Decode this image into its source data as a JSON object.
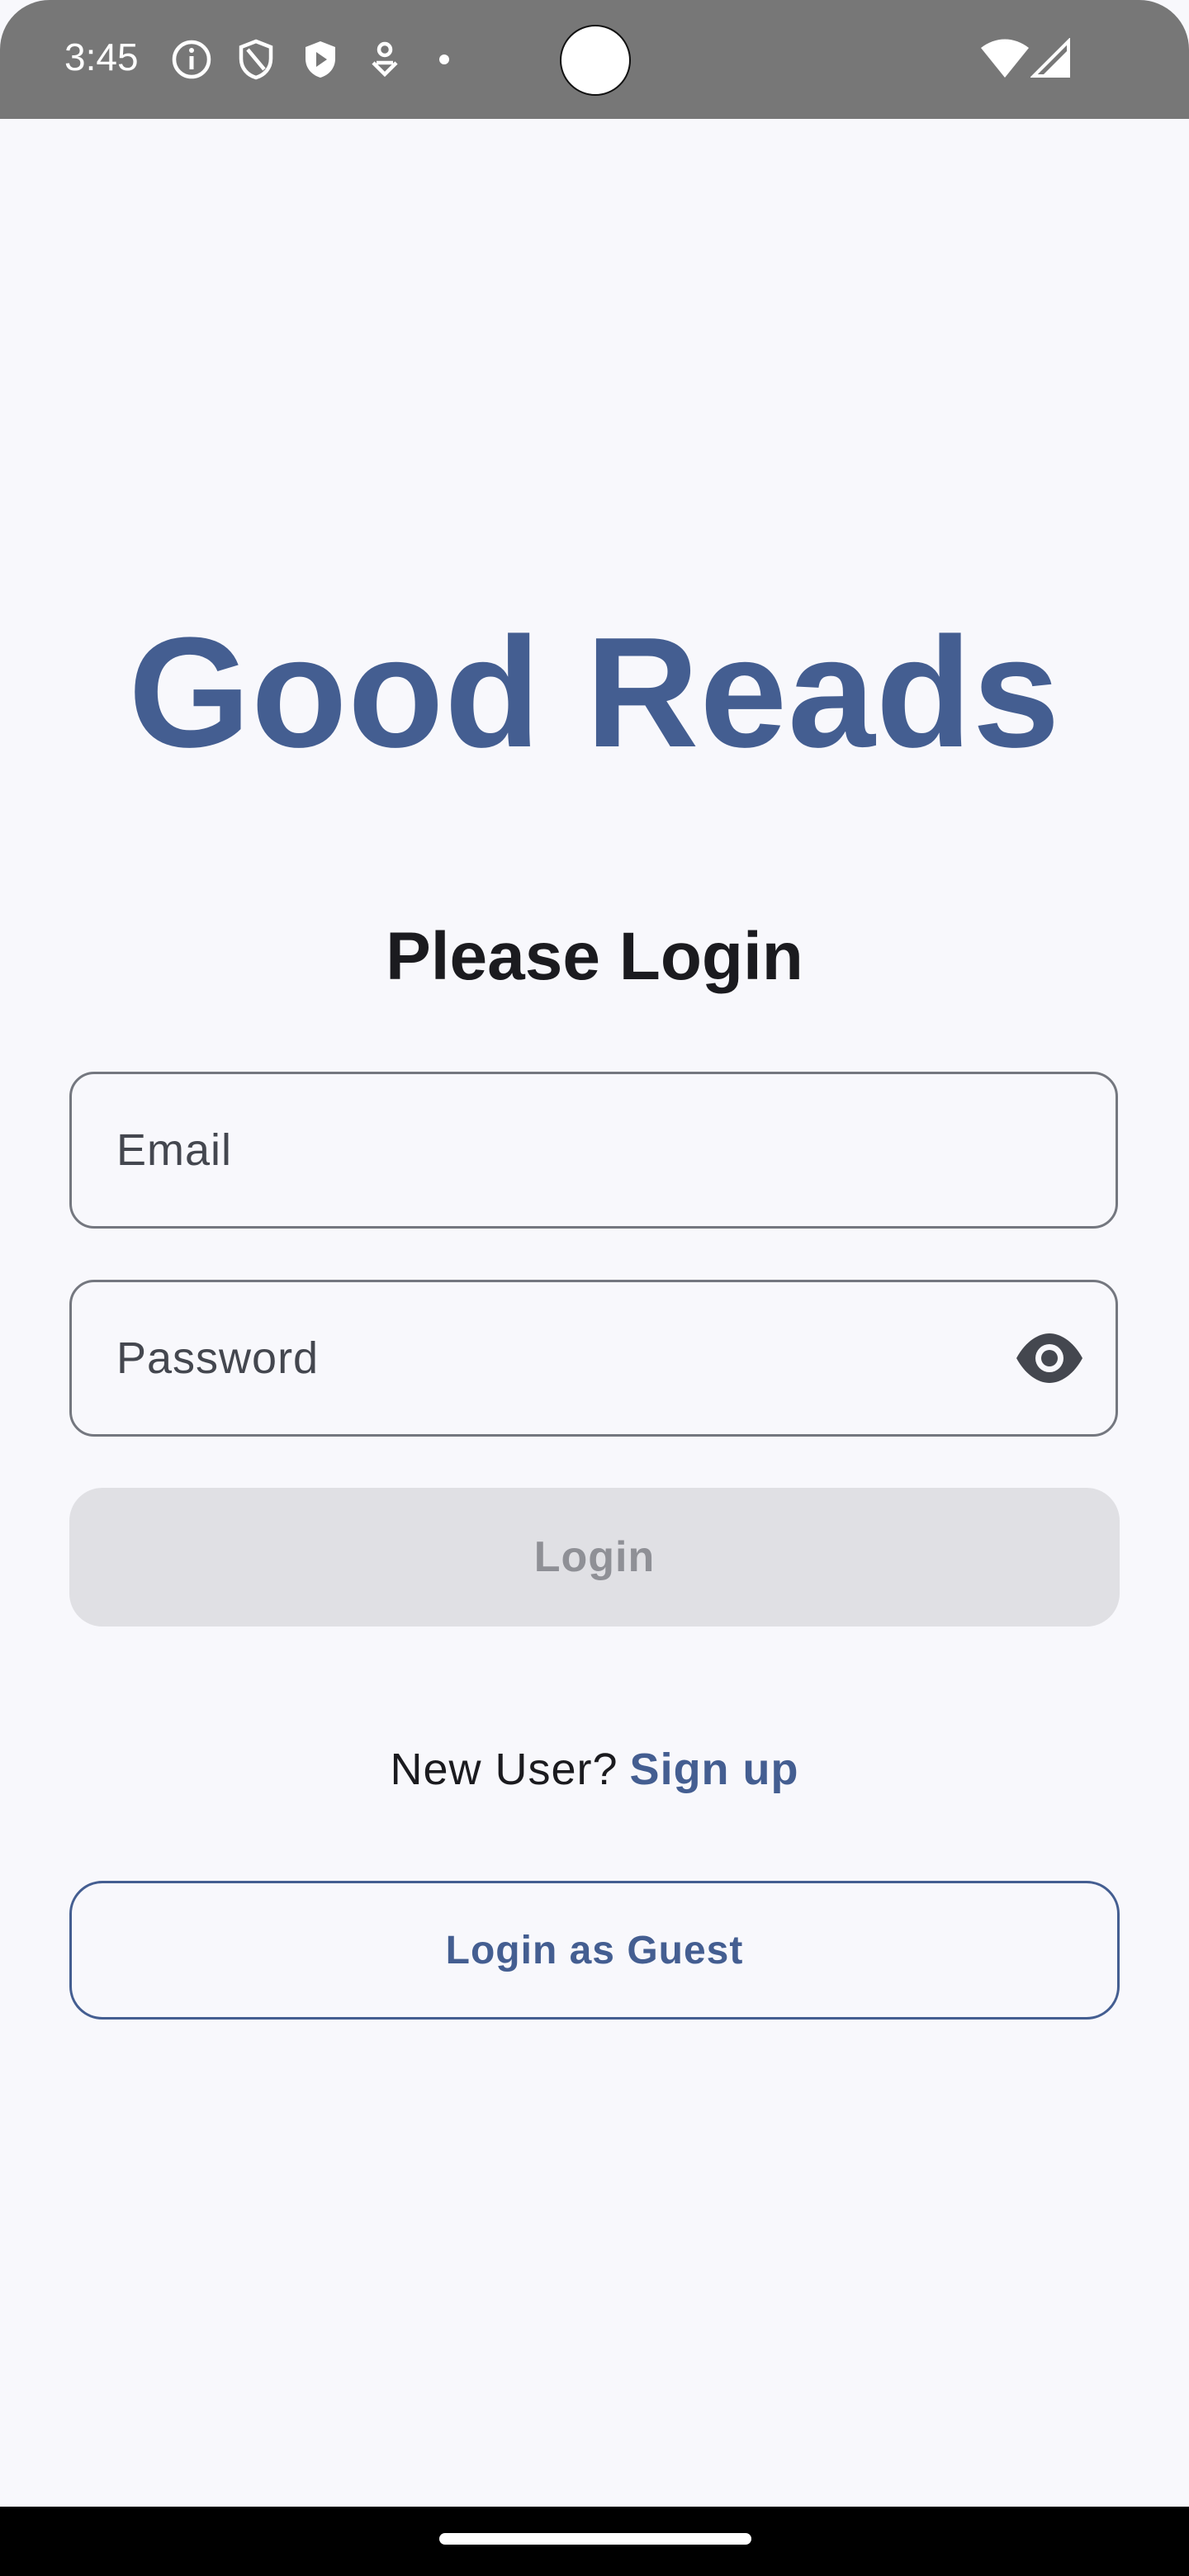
{
  "status_bar": {
    "time": "3:45",
    "left_icons": [
      "info-icon",
      "shield-outline-icon",
      "play-shield-icon",
      "pin-icon",
      "dot-icon"
    ],
    "right_icons": [
      "wifi-icon",
      "cellular-signal-icon"
    ]
  },
  "app": {
    "title": "Good Reads",
    "subtitle": "Please Login"
  },
  "form": {
    "email_placeholder": "Email",
    "password_placeholder": "Password",
    "login_label": "Login",
    "new_user_text": "New User?",
    "signup_label": "Sign up",
    "guest_label": "Login as Guest"
  },
  "colors": {
    "primary": "#445e91",
    "background": "#f8f8fc",
    "disabled_button": "#e0e0e4",
    "status_bar": "#777777"
  }
}
